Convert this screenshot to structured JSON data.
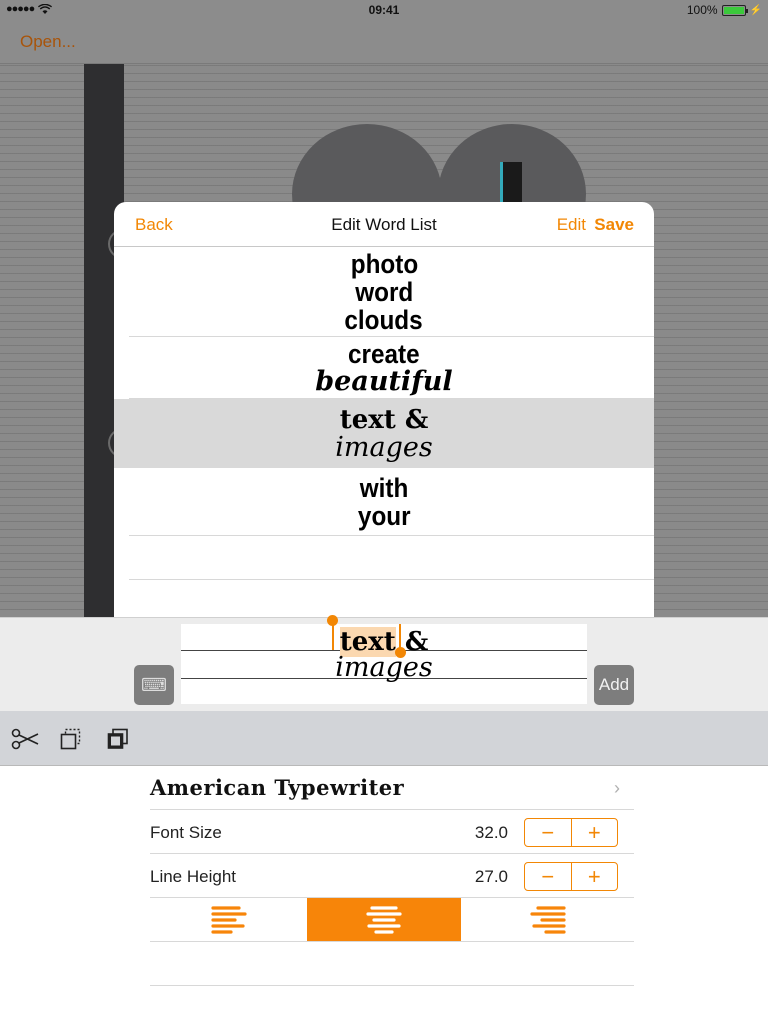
{
  "status_bar": {
    "time": "09:41",
    "battery": "100%"
  },
  "nav": {
    "open_label": "Open..."
  },
  "modal": {
    "back_label": "Back",
    "title": "Edit Word List",
    "edit_label": "Edit",
    "save_label": "Save",
    "rows": [
      {
        "lines": [
          "photo",
          "word",
          "clouds"
        ]
      },
      {
        "lines": [
          "create",
          "beautiful"
        ]
      },
      {
        "lines": [
          "text &",
          "images"
        ],
        "selected": true
      },
      {
        "lines": [
          "with",
          "your"
        ]
      }
    ]
  },
  "editor": {
    "line1_selected": "text",
    "line1_rest": " &",
    "line2": "images",
    "add_label": "Add",
    "keyboard_icon": "keyboard-icon"
  },
  "toolbar": {
    "icons": [
      "scissors-icon",
      "copy-icon",
      "paste-icon"
    ]
  },
  "settings": {
    "font_name": "American Typewriter",
    "font_size_label": "Font Size",
    "font_size_value": "32.0",
    "line_height_label": "Line Height",
    "line_height_value": "27.0",
    "alignment_selected": "center"
  },
  "colors": {
    "accent": "#f28705",
    "selected_row": "#d9d9d9"
  }
}
